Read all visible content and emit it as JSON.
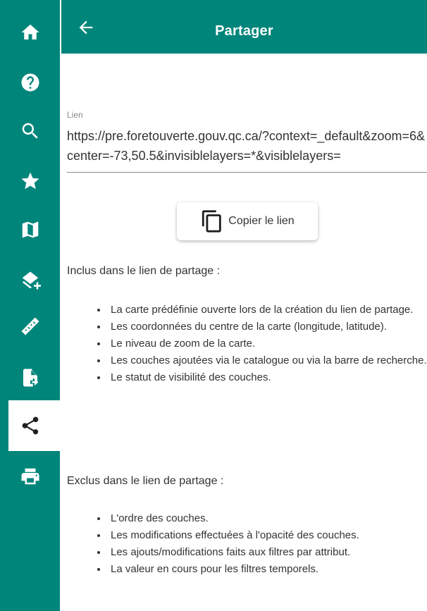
{
  "sidebar": {
    "items": [
      {
        "icon": "home-icon"
      },
      {
        "icon": "help-icon"
      },
      {
        "icon": "search-icon"
      },
      {
        "icon": "star-icon"
      },
      {
        "icon": "map-icon"
      },
      {
        "icon": "add-layer-icon"
      },
      {
        "icon": "ruler-icon"
      },
      {
        "icon": "file-export-icon"
      },
      {
        "icon": "share-icon",
        "active": true
      },
      {
        "icon": "print-icon"
      }
    ],
    "color": "#00857a"
  },
  "header": {
    "title": "Partager",
    "back_icon": "arrow-left-icon"
  },
  "link_field": {
    "label": "Lien",
    "value": "https://pre.foretouverte.gouv.qc.ca/?context=_default&zoom=6&center=-73,50.5&invisiblelayers=*&visiblelayers="
  },
  "copy_button": {
    "label": "Copier le lien",
    "icon": "copy-icon"
  },
  "included": {
    "title": "Inclus dans le lien de partage :",
    "items": [
      "La carte prédéfinie ouverte lors de la création du lien de partage.",
      "Les coordonnées du centre de la carte (longitude, latitude).",
      "Le niveau de zoom de la carte.",
      "Les couches ajoutées via le catalogue ou via la barre de recherche.",
      "Le statut de visibilité des couches."
    ]
  },
  "excluded": {
    "title": "Exclus dans le lien de partage :",
    "items": [
      "L'ordre des couches.",
      "Les modifications effectuées à l'opacité des couches.",
      "Les ajouts/modifications faits aux filtres par attribut.",
      "La valeur en cours pour les filtres temporels."
    ]
  }
}
